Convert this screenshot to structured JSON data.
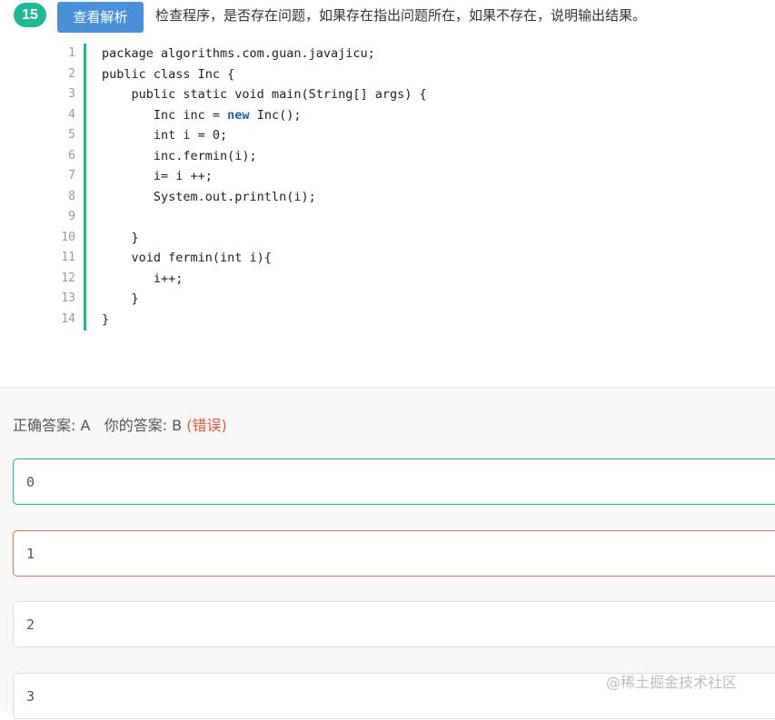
{
  "question": {
    "number": "15",
    "analysis_button": "查看解析",
    "text": "检查程序，是否存在问题，如果存在指出问题所在，如果不存在，说明输出结果。"
  },
  "code": {
    "lines": [
      "package algorithms.com.guan.javajicu;",
      "public class Inc {",
      "    public static void main(String[] args) {",
      "       Inc inc = new Inc();",
      "       int i = 0;",
      "       inc.fermin(i);",
      "       i= i ++;",
      "       System.out.println(i);",
      "",
      "    }",
      "    void fermin(int i){",
      "       i++;",
      "    }",
      "}"
    ],
    "line_numbers": [
      "1",
      "2",
      "3",
      "4",
      "5",
      "6",
      "7",
      "8",
      "9",
      "10",
      "11",
      "12",
      "13",
      "14"
    ]
  },
  "answer": {
    "correct_label": "正确答案: A",
    "your_label": "你的答案: B",
    "status": "(错误)"
  },
  "options": [
    {
      "text": "0",
      "state": "correct"
    },
    {
      "text": "1",
      "state": "wrong"
    },
    {
      "text": "2",
      "state": "neutral"
    },
    {
      "text": "3",
      "state": "neutral"
    }
  ],
  "watermark": "@稀土掘金技术社区",
  "colors": {
    "accent": "#1fb894",
    "button": "#4a90d9",
    "error": "#e05a3a"
  }
}
